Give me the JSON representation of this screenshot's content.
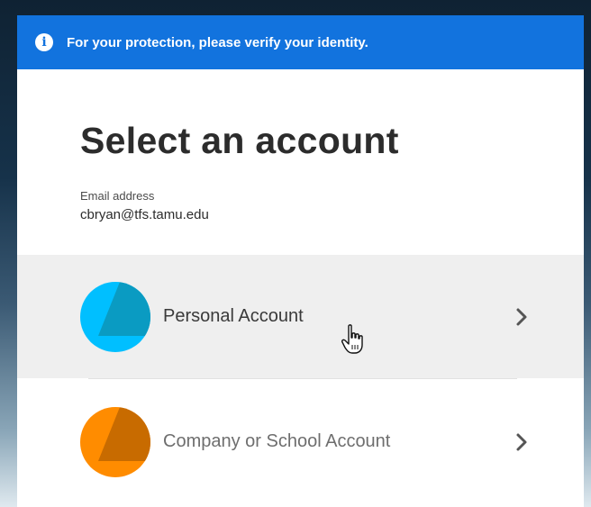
{
  "banner": {
    "icon": "info-icon",
    "text": "For your protection, please verify your identity."
  },
  "title": "Select an account",
  "email": {
    "label": "Email address",
    "value": "cbryan@tfs.tamu.edu"
  },
  "accounts": [
    {
      "label": "Personal Account",
      "avatar_color": "#00bfff",
      "avatar_shade": "#0a9bc2",
      "chevron": "chevron-right-icon",
      "hovered": true
    },
    {
      "label": "Company or School Account",
      "avatar_color": "#ff8c00",
      "avatar_shade": "#c86b00",
      "chevron": "chevron-right-icon",
      "hovered": false
    }
  ],
  "colors": {
    "banner_bg": "#1273de",
    "hover_bg": "#efefef"
  }
}
